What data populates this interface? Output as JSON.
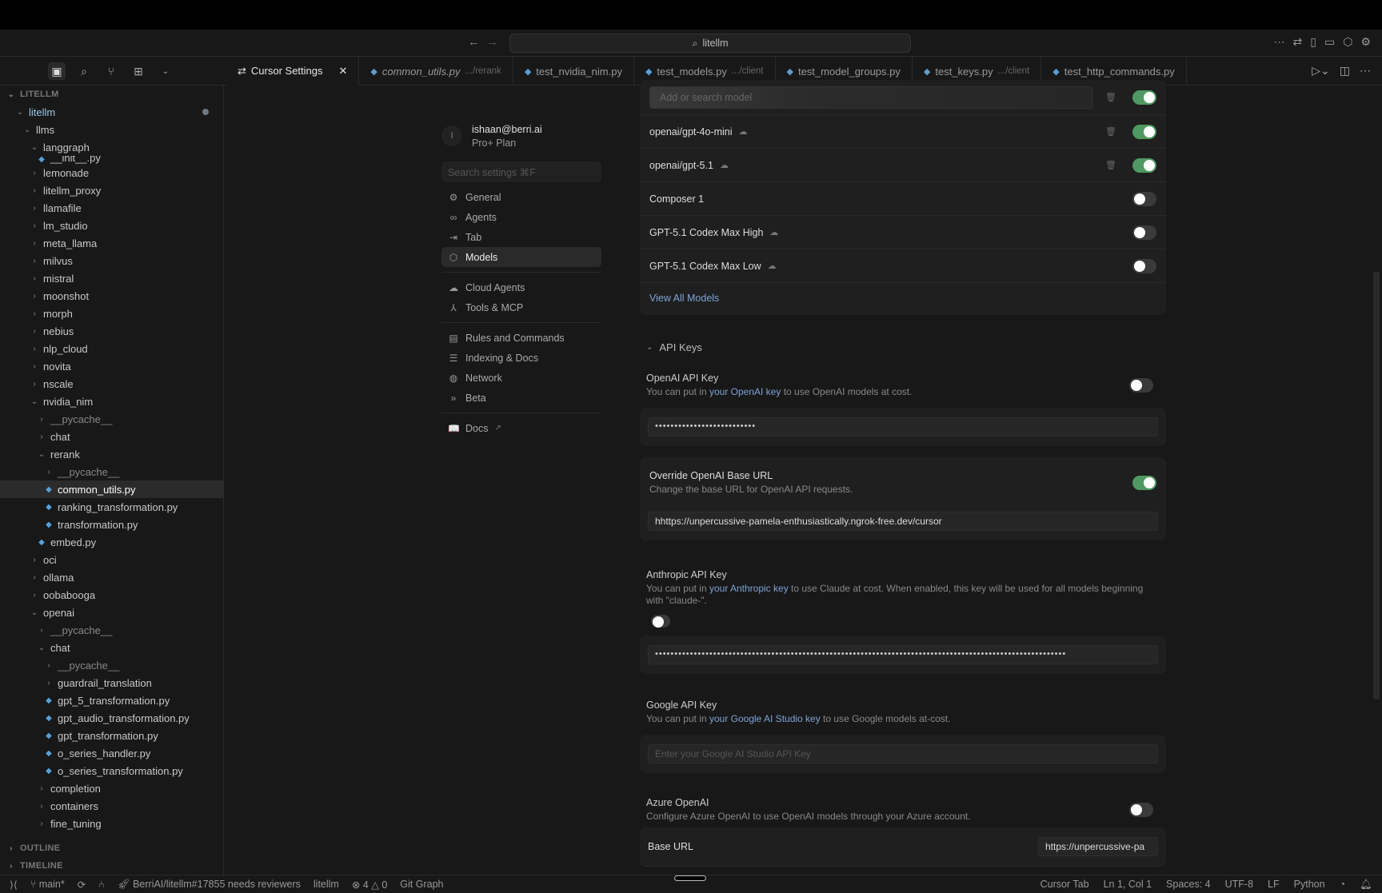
{
  "titlebar": {
    "search": "litellm"
  },
  "activity_icons": [
    "files-icon",
    "search-icon",
    "source-control-icon",
    "extensions-icon",
    "chevron-down-icon"
  ],
  "tabs": [
    {
      "name": "Cursor Settings",
      "hint": "",
      "active": true
    },
    {
      "name": "common_utils.py",
      "hint": ".../rerank",
      "italic": true
    },
    {
      "name": "test_nvidia_nim.py",
      "hint": ""
    },
    {
      "name": "test_models.py",
      "hint": ".../client"
    },
    {
      "name": "test_model_groups.py",
      "hint": ""
    },
    {
      "name": "test_keys.py",
      "hint": ".../client"
    },
    {
      "name": "test_http_commands.py",
      "hint": ""
    }
  ],
  "explorer": {
    "root": "LITELLM",
    "items": [
      {
        "n": "litellm",
        "d": 1,
        "t": "open",
        "root": true
      },
      {
        "n": "llms",
        "d": 2,
        "t": "open"
      },
      {
        "n": "langgraph",
        "d": 3,
        "t": "open"
      },
      {
        "n": "__init__.py",
        "d": 4,
        "t": "file",
        "clip": true
      },
      {
        "n": "lemonade",
        "d": 3,
        "t": "closed"
      },
      {
        "n": "litellm_proxy",
        "d": 3,
        "t": "closed"
      },
      {
        "n": "llamafile",
        "d": 3,
        "t": "closed"
      },
      {
        "n": "lm_studio",
        "d": 3,
        "t": "closed"
      },
      {
        "n": "meta_llama",
        "d": 3,
        "t": "closed"
      },
      {
        "n": "milvus",
        "d": 3,
        "t": "closed"
      },
      {
        "n": "mistral",
        "d": 3,
        "t": "closed"
      },
      {
        "n": "moonshot",
        "d": 3,
        "t": "closed"
      },
      {
        "n": "morph",
        "d": 3,
        "t": "closed"
      },
      {
        "n": "nebius",
        "d": 3,
        "t": "closed"
      },
      {
        "n": "nlp_cloud",
        "d": 3,
        "t": "closed"
      },
      {
        "n": "novita",
        "d": 3,
        "t": "closed"
      },
      {
        "n": "nscale",
        "d": 3,
        "t": "closed"
      },
      {
        "n": "nvidia_nim",
        "d": 3,
        "t": "open"
      },
      {
        "n": "__pycache__",
        "d": 4,
        "t": "closed",
        "dim": true
      },
      {
        "n": "chat",
        "d": 4,
        "t": "closed"
      },
      {
        "n": "rerank",
        "d": 4,
        "t": "open"
      },
      {
        "n": "__pycache__",
        "d": 5,
        "t": "closed",
        "dim": true
      },
      {
        "n": "common_utils.py",
        "d": 5,
        "t": "file",
        "sel": true
      },
      {
        "n": "ranking_transformation.py",
        "d": 5,
        "t": "file"
      },
      {
        "n": "transformation.py",
        "d": 5,
        "t": "file"
      },
      {
        "n": "embed.py",
        "d": 4,
        "t": "file"
      },
      {
        "n": "oci",
        "d": 3,
        "t": "closed"
      },
      {
        "n": "ollama",
        "d": 3,
        "t": "closed"
      },
      {
        "n": "oobabooga",
        "d": 3,
        "t": "closed"
      },
      {
        "n": "openai",
        "d": 3,
        "t": "open"
      },
      {
        "n": "__pycache__",
        "d": 4,
        "t": "closed",
        "dim": true
      },
      {
        "n": "chat",
        "d": 4,
        "t": "open"
      },
      {
        "n": "__pycache__",
        "d": 5,
        "t": "closed",
        "dim": true
      },
      {
        "n": "guardrail_translation",
        "d": 5,
        "t": "closed"
      },
      {
        "n": "gpt_5_transformation.py",
        "d": 5,
        "t": "file"
      },
      {
        "n": "gpt_audio_transformation.py",
        "d": 5,
        "t": "file"
      },
      {
        "n": "gpt_transformation.py",
        "d": 5,
        "t": "file"
      },
      {
        "n": "o_series_handler.py",
        "d": 5,
        "t": "file"
      },
      {
        "n": "o_series_transformation.py",
        "d": 5,
        "t": "file"
      },
      {
        "n": "completion",
        "d": 4,
        "t": "closed"
      },
      {
        "n": "containers",
        "d": 4,
        "t": "closed"
      },
      {
        "n": "fine_tuning",
        "d": 4,
        "t": "closed"
      }
    ],
    "outline": "OUTLINE",
    "timeline": "TIMELINE"
  },
  "settings_nav": {
    "avatar": "I",
    "email": "ishaan@berri.ai",
    "plan": "Pro+ Plan",
    "search_placeholder": "Search settings ⌘F",
    "groups": [
      [
        {
          "label": "General",
          "icon": "⚙"
        },
        {
          "label": "Agents",
          "icon": "∞"
        },
        {
          "label": "Tab",
          "icon": "⇥"
        },
        {
          "label": "Models",
          "icon": "⬡",
          "selected": true
        }
      ],
      [
        {
          "label": "Cloud Agents",
          "icon": "☁"
        },
        {
          "label": "Tools & MCP",
          "icon": "⅄"
        }
      ],
      [
        {
          "label": "Rules and Commands",
          "icon": "▤"
        },
        {
          "label": "Indexing & Docs",
          "icon": "☰"
        },
        {
          "label": "Network",
          "icon": "◍"
        },
        {
          "label": "Beta",
          "icon": "»"
        }
      ],
      [
        {
          "label": "Docs",
          "icon": "📖",
          "ext": "↗"
        }
      ]
    ]
  },
  "models": {
    "search_placeholder": "Add or search model",
    "search_toggle_on": true,
    "rows": [
      {
        "name": "openai/gpt-4o-mini",
        "brain": true,
        "trash": true,
        "on": true
      },
      {
        "name": "openai/gpt-5.1",
        "brain": true,
        "trash": true,
        "on": true
      },
      {
        "name": "Composer 1",
        "brain": false,
        "trash": false,
        "on": false
      },
      {
        "name": "GPT-5.1 Codex Max High",
        "brain": true,
        "trash": false,
        "on": false
      },
      {
        "name": "GPT-5.1 Codex Max Low",
        "brain": true,
        "trash": false,
        "on": false
      }
    ],
    "view_all": "View All Models"
  },
  "api_keys": {
    "heading": "API Keys",
    "openai": {
      "title": "OpenAI API Key",
      "pre": "You can put in ",
      "link": "your OpenAI key",
      "post": " to use OpenAI models at cost.",
      "on": false,
      "value": "••••••••••••••••••••••••••"
    },
    "override": {
      "title": "Override OpenAI Base URL",
      "desc": "Change the base URL for OpenAI API requests.",
      "on": true,
      "value": "hhttps://unpercussive-pamela-enthusiastically.ngrok-free.dev/cursor"
    },
    "anthropic": {
      "title": "Anthropic API Key",
      "pre": "You can put in ",
      "link": "your Anthropic key",
      "post": " to use Claude at cost. When enabled, this key will be used for all models beginning with \"claude-\".",
      "on": false,
      "value": "••••••••••••••••••••••••••••••••••••••••••••••••••••••••••••••••••••••••••••••••••••••••••••••••••••••••••"
    },
    "google": {
      "title": "Google API Key",
      "pre": "You can put in ",
      "link": "your Google AI Studio key",
      "post": " to use Google models at-cost.",
      "placeholder": "Enter your Google AI Studio API Key"
    },
    "azure": {
      "title": "Azure OpenAI",
      "desc": "Configure Azure OpenAI to use OpenAI models through your Azure account.",
      "on": false,
      "base_url_label": "Base URL",
      "base_url_value": "https://unpercussive-pa"
    }
  },
  "statusbar": {
    "branch": "main*",
    "pr": "BerriAI/litellm#17855 needs reviewers",
    "project": "litellm",
    "errors": "4",
    "warnings": "0",
    "git_graph": "Git Graph",
    "cursor_tab": "Cursor Tab",
    "position": "Ln 1, Col 1",
    "spaces": "Spaces: 4",
    "encoding": "UTF-8",
    "eol": "LF",
    "language": "Python"
  }
}
